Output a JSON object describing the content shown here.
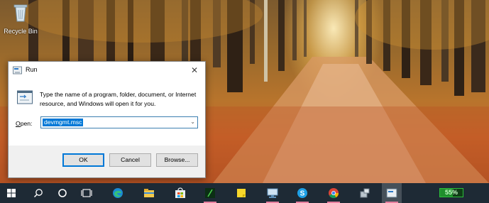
{
  "desktop": {
    "recycle_bin_label": "Recycle Bin"
  },
  "run_dialog": {
    "title": "Run",
    "close_glyph": "✕",
    "description": "Type the name of a program, folder, document, or Internet resource, and Windows will open it for you.",
    "open_label_prefix": "O",
    "open_label_rest": "pen:",
    "open_value": "devmgmt.msc",
    "ok_label": "OK",
    "cancel_label": "Cancel",
    "browse_label": "Browse..."
  },
  "taskbar": {
    "items": [
      "start-icon",
      "search-icon",
      "cortana-icon",
      "task-view-icon",
      "edge-icon",
      "file-explorer-icon",
      "store-icon",
      "terminal-icon",
      "sticky-notes-icon",
      "network-icon",
      "skype-icon",
      "chrome-icon",
      "device-manager-icon",
      "run-icon"
    ],
    "accent_underline": "#e87f9f",
    "battery_percent": "55%",
    "battery_level": 0.55
  }
}
